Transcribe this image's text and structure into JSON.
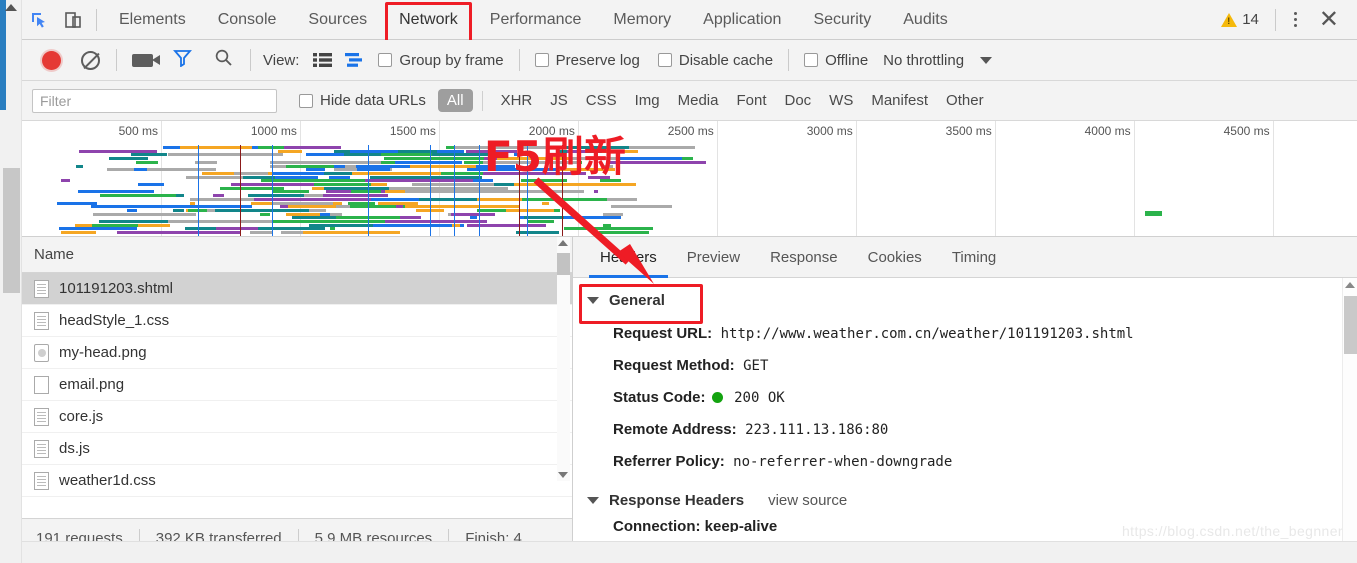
{
  "window": {
    "warning_count": "14",
    "close_label": "✕"
  },
  "main_tabs": [
    {
      "label": "Elements",
      "active": false
    },
    {
      "label": "Console",
      "active": false
    },
    {
      "label": "Sources",
      "active": false
    },
    {
      "label": "Network",
      "active": true
    },
    {
      "label": "Performance",
      "active": false
    },
    {
      "label": "Memory",
      "active": false
    },
    {
      "label": "Application",
      "active": false
    },
    {
      "label": "Security",
      "active": false
    },
    {
      "label": "Audits",
      "active": false
    }
  ],
  "network_toolbar": {
    "record_tooltip": "record-button",
    "clear_tooltip": "clear-button",
    "view_label": "View:",
    "group_by_frame": "Group by frame",
    "preserve_log": "Preserve log",
    "disable_cache": "Disable cache",
    "offline": "Offline",
    "throttling": "No throttling"
  },
  "filter_bar": {
    "filter_placeholder": "Filter",
    "hide_data_urls": "Hide data URLs",
    "selected_type": "All",
    "types": [
      "XHR",
      "JS",
      "CSS",
      "Img",
      "Media",
      "Font",
      "Doc",
      "WS",
      "Manifest",
      "Other"
    ]
  },
  "overview": {
    "ticks": [
      "500 ms",
      "1000 ms",
      "1500 ms",
      "2000 ms",
      "2500 ms",
      "3000 ms",
      "3500 ms",
      "4000 ms",
      "4500 ms"
    ]
  },
  "annotation": {
    "text": "F5刷新",
    "color": "#ee1c25"
  },
  "request_list": {
    "column_header": "Name",
    "rows": [
      {
        "name": "101191203.shtml",
        "icon": "document-icon",
        "selected": true
      },
      {
        "name": "headStyle_1.css",
        "icon": "document-icon",
        "selected": false
      },
      {
        "name": "my-head.png",
        "icon": "image-icon",
        "selected": false
      },
      {
        "name": "email.png",
        "icon": "blank-icon",
        "selected": false
      },
      {
        "name": "core.js",
        "icon": "document-icon",
        "selected": false
      },
      {
        "name": "ds.js",
        "icon": "document-icon",
        "selected": false
      },
      {
        "name": "weather1d.css",
        "icon": "document-icon",
        "selected": false
      }
    ]
  },
  "status_bar": {
    "requests": "191 requests",
    "transferred": "392 KB transferred",
    "resources": "5.9 MB resources",
    "finish": "Finish: 4"
  },
  "detail_tabs": [
    {
      "label": "Headers",
      "active": true
    },
    {
      "label": "Preview",
      "active": false
    },
    {
      "label": "Response",
      "active": false
    },
    {
      "label": "Cookies",
      "active": false
    },
    {
      "label": "Timing",
      "active": false
    }
  ],
  "headers": {
    "general_title": "General",
    "general": [
      {
        "key": "Request URL:",
        "value": "http://www.weather.com.cn/weather/101191203.shtml",
        "status_dot": false
      },
      {
        "key": "Request Method:",
        "value": "GET",
        "status_dot": false
      },
      {
        "key": "Status Code:",
        "value": "200  OK",
        "status_dot": true
      },
      {
        "key": "Remote Address:",
        "value": "223.111.13.186:80",
        "status_dot": false
      },
      {
        "key": "Referrer Policy:",
        "value": "no-referrer-when-downgrade",
        "status_dot": false
      }
    ],
    "response_headers_title": "Response Headers",
    "view_source": "view source",
    "first_response_header": "Connection: keep-alive"
  },
  "watermark": {
    "text": "https://blog.csdn.net/the_begnner"
  },
  "colors": {
    "accent_blue": "#1a73e8",
    "annotation_red": "#ee1c25",
    "status_green": "#14a310",
    "warn_yellow": "#f5b90b",
    "record_red": "#e53935"
  }
}
